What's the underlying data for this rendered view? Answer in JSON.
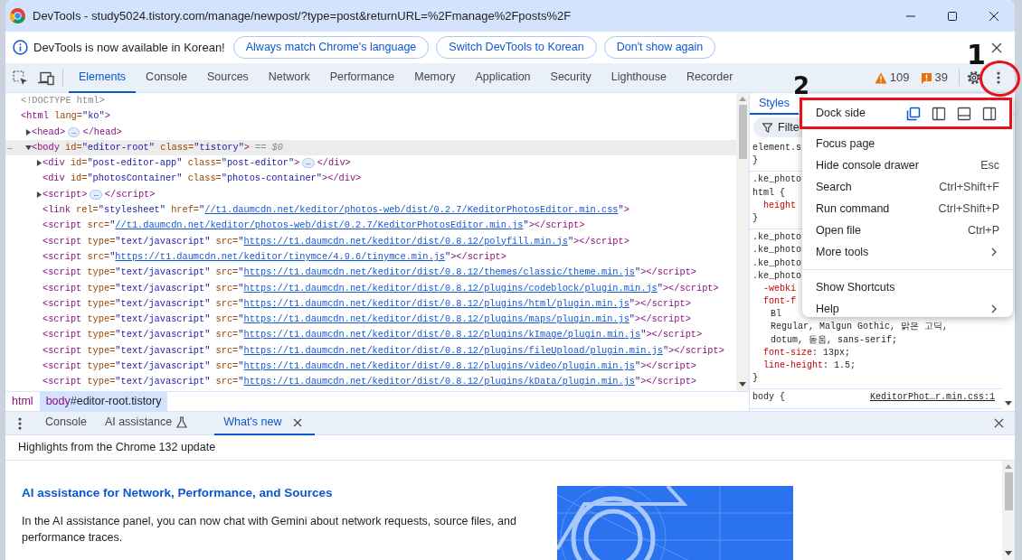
{
  "window": {
    "title": "DevTools - study5024.tistory.com/manage/newpost/?type=post&returnURL=%2Fmanage%2Fposts%2F"
  },
  "infobar": {
    "message": "DevTools is now available in Korean!",
    "buttons": [
      "Always match Chrome's language",
      "Switch DevTools to Korean",
      "Don't show again"
    ]
  },
  "tabs": [
    {
      "label": "Elements",
      "selected": true
    },
    {
      "label": "Console",
      "selected": false
    },
    {
      "label": "Sources",
      "selected": false
    },
    {
      "label": "Network",
      "selected": false
    },
    {
      "label": "Performance",
      "selected": false
    },
    {
      "label": "Memory",
      "selected": false
    },
    {
      "label": "Application",
      "selected": false
    },
    {
      "label": "Security",
      "selected": false
    },
    {
      "label": "Lighthouse",
      "selected": false
    },
    {
      "label": "Recorder",
      "selected": false
    }
  ],
  "counters": [
    {
      "kind": "warning",
      "count": "109"
    },
    {
      "kind": "issue",
      "count": "39"
    }
  ],
  "dom_tree": [
    {
      "tokens": [
        {
          "kind": "comment",
          "text": "<!DOCTYPE html>"
        }
      ],
      "selected": false
    },
    {
      "tokens": [
        {
          "kind": "tag",
          "text": "<html"
        },
        {
          "kind": "attr",
          "text": " lang="
        },
        {
          "kind": "value",
          "text": "\"ko\""
        },
        {
          "kind": "tag",
          "text": ">"
        }
      ],
      "selected": false,
      "children": [
        {
          "tokens": [
            {
              "kind": "tag",
              "text": "<head>"
            },
            {
              "kind": "more",
              "text": "…"
            },
            {
              "kind": "tag",
              "text": "</head>"
            }
          ],
          "expanded": false,
          "selected": false
        },
        {
          "tokens": [
            {
              "kind": "tag",
              "text": "<body"
            },
            {
              "kind": "attr",
              "text": " id="
            },
            {
              "kind": "value",
              "text": "\"editor-root\""
            },
            {
              "kind": "attr",
              "text": " class="
            },
            {
              "kind": "value",
              "text": "\"tistory\""
            },
            {
              "kind": "tag",
              "text": ">"
            },
            {
              "kind": "ref",
              "text": "== $0"
            }
          ],
          "expanded": true,
          "selected": true,
          "gutter": "…",
          "children": [
            {
              "tokens": [
                {
                  "kind": "tag",
                  "text": "<div"
                },
                {
                  "kind": "attr",
                  "text": " id="
                },
                {
                  "kind": "value",
                  "text": "\"post-editor-app\""
                },
                {
                  "kind": "attr",
                  "text": " class="
                },
                {
                  "kind": "value",
                  "text": "\"post-editor\""
                },
                {
                  "kind": "tag",
                  "text": ">"
                },
                {
                  "kind": "more",
                  "text": "…"
                },
                {
                  "kind": "tag",
                  "text": "</div>"
                }
              ],
              "expanded": false,
              "selected": false
            },
            {
              "tokens": [
                {
                  "kind": "tag",
                  "text": "<div"
                },
                {
                  "kind": "attr",
                  "text": " id="
                },
                {
                  "kind": "value",
                  "text": "\"photosContainer\""
                },
                {
                  "kind": "attr",
                  "text": " class="
                },
                {
                  "kind": "value",
                  "text": "\"photos-container\""
                },
                {
                  "kind": "tag",
                  "text": "></div>"
                }
              ],
              "selected": false
            },
            {
              "tokens": [
                {
                  "kind": "tag",
                  "text": "<script>"
                },
                {
                  "kind": "more",
                  "text": "…"
                },
                {
                  "kind": "tag",
                  "text": "</script>"
                }
              ],
              "expanded": false,
              "selected": false
            },
            {
              "tokens": [
                {
                  "kind": "tag",
                  "text": "<link"
                },
                {
                  "kind": "attr",
                  "text": " rel="
                },
                {
                  "kind": "value",
                  "text": "\"stylesheet\""
                },
                {
                  "kind": "attr",
                  "text": " href="
                },
                {
                  "kind": "value",
                  "text": "\""
                },
                {
                  "kind": "link",
                  "text": "//t1.daumcdn.net/keditor/photos-web/dist/0.2.7/KeditorPhotosEditor.min.css"
                },
                {
                  "kind": "value",
                  "text": "\""
                },
                {
                  "kind": "tag",
                  "text": ">"
                }
              ],
              "selected": false
            },
            {
              "tokens": [
                {
                  "kind": "tag",
                  "text": "<script"
                },
                {
                  "kind": "attr",
                  "text": " src="
                },
                {
                  "kind": "value",
                  "text": "\""
                },
                {
                  "kind": "link",
                  "text": "//t1.daumcdn.net/keditor/photos-web/dist/0.2.7/KeditorPhotosEditor.min.js"
                },
                {
                  "kind": "value",
                  "text": "\""
                },
                {
                  "kind": "tag",
                  "text": "></script>"
                }
              ],
              "selected": false
            },
            {
              "tokens": [
                {
                  "kind": "tag",
                  "text": "<script"
                },
                {
                  "kind": "attr",
                  "text": " type="
                },
                {
                  "kind": "value",
                  "text": "\"text/javascript\""
                },
                {
                  "kind": "attr",
                  "text": " src="
                },
                {
                  "kind": "value",
                  "text": "\""
                },
                {
                  "kind": "link",
                  "text": "https://t1.daumcdn.net/keditor/dist/0.8.12/polyfill.min.js"
                },
                {
                  "kind": "value",
                  "text": "\""
                },
                {
                  "kind": "tag",
                  "text": "></script>"
                }
              ],
              "selected": false
            },
            {
              "tokens": [
                {
                  "kind": "tag",
                  "text": "<script"
                },
                {
                  "kind": "attr",
                  "text": " src="
                },
                {
                  "kind": "value",
                  "text": "\""
                },
                {
                  "kind": "link",
                  "text": "https://t1.daumcdn.net/keditor/tinymce/4.9.6/tinymce.min.js"
                },
                {
                  "kind": "value",
                  "text": "\""
                },
                {
                  "kind": "tag",
                  "text": "></script>"
                }
              ],
              "selected": false
            },
            {
              "tokens": [
                {
                  "kind": "tag",
                  "text": "<script"
                },
                {
                  "kind": "attr",
                  "text": " type="
                },
                {
                  "kind": "value",
                  "text": "\"text/javascript\""
                },
                {
                  "kind": "attr",
                  "text": " src="
                },
                {
                  "kind": "value",
                  "text": "\""
                },
                {
                  "kind": "link",
                  "text": "https://t1.daumcdn.net/keditor/dist/0.8.12/themes/classic/theme.min.js"
                },
                {
                  "kind": "value",
                  "text": "\""
                },
                {
                  "kind": "tag",
                  "text": "></script>"
                }
              ],
              "selected": false
            },
            {
              "tokens": [
                {
                  "kind": "tag",
                  "text": "<script"
                },
                {
                  "kind": "attr",
                  "text": " type="
                },
                {
                  "kind": "value",
                  "text": "\"text/javascript\""
                },
                {
                  "kind": "attr",
                  "text": " src="
                },
                {
                  "kind": "value",
                  "text": "\""
                },
                {
                  "kind": "link",
                  "text": "https://t1.daumcdn.net/keditor/dist/0.8.12/plugins/codeblock/plugin.min.js"
                },
                {
                  "kind": "value",
                  "text": "\""
                },
                {
                  "kind": "tag",
                  "text": "></script>"
                }
              ],
              "selected": false
            },
            {
              "tokens": [
                {
                  "kind": "tag",
                  "text": "<script"
                },
                {
                  "kind": "attr",
                  "text": " type="
                },
                {
                  "kind": "value",
                  "text": "\"text/javascript\""
                },
                {
                  "kind": "attr",
                  "text": " src="
                },
                {
                  "kind": "value",
                  "text": "\""
                },
                {
                  "kind": "link",
                  "text": "https://t1.daumcdn.net/keditor/dist/0.8.12/plugins/html/plugin.min.js"
                },
                {
                  "kind": "value",
                  "text": "\""
                },
                {
                  "kind": "tag",
                  "text": "></script>"
                }
              ],
              "selected": false
            },
            {
              "tokens": [
                {
                  "kind": "tag",
                  "text": "<script"
                },
                {
                  "kind": "attr",
                  "text": " type="
                },
                {
                  "kind": "value",
                  "text": "\"text/javascript\""
                },
                {
                  "kind": "attr",
                  "text": " src="
                },
                {
                  "kind": "value",
                  "text": "\""
                },
                {
                  "kind": "link",
                  "text": "https://t1.daumcdn.net/keditor/dist/0.8.12/plugins/maps/plugin.min.js"
                },
                {
                  "kind": "value",
                  "text": "\""
                },
                {
                  "kind": "tag",
                  "text": "></script>"
                }
              ],
              "selected": false
            },
            {
              "tokens": [
                {
                  "kind": "tag",
                  "text": "<script"
                },
                {
                  "kind": "attr",
                  "text": " type="
                },
                {
                  "kind": "value",
                  "text": "\"text/javascript\""
                },
                {
                  "kind": "attr",
                  "text": " src="
                },
                {
                  "kind": "value",
                  "text": "\""
                },
                {
                  "kind": "link",
                  "text": "https://t1.daumcdn.net/keditor/dist/0.8.12/plugins/kImage/plugin.min.js"
                },
                {
                  "kind": "value",
                  "text": "\""
                },
                {
                  "kind": "tag",
                  "text": "></script>"
                }
              ],
              "selected": false
            },
            {
              "tokens": [
                {
                  "kind": "tag",
                  "text": "<script"
                },
                {
                  "kind": "attr",
                  "text": " type="
                },
                {
                  "kind": "value",
                  "text": "\"text/javascript\""
                },
                {
                  "kind": "attr",
                  "text": " src="
                },
                {
                  "kind": "value",
                  "text": "\""
                },
                {
                  "kind": "link",
                  "text": "https://t1.daumcdn.net/keditor/dist/0.8.12/plugins/fileUpload/plugin.min.js"
                },
                {
                  "kind": "value",
                  "text": "\""
                },
                {
                  "kind": "tag",
                  "text": "></script>"
                }
              ],
              "selected": false
            },
            {
              "tokens": [
                {
                  "kind": "tag",
                  "text": "<script"
                },
                {
                  "kind": "attr",
                  "text": " type="
                },
                {
                  "kind": "value",
                  "text": "\"text/javascript\""
                },
                {
                  "kind": "attr",
                  "text": " src="
                },
                {
                  "kind": "value",
                  "text": "\""
                },
                {
                  "kind": "link",
                  "text": "https://t1.daumcdn.net/keditor/dist/0.8.12/plugins/video/plugin.min.js"
                },
                {
                  "kind": "value",
                  "text": "\""
                },
                {
                  "kind": "tag",
                  "text": "></script>"
                }
              ],
              "selected": false
            },
            {
              "tokens": [
                {
                  "kind": "tag",
                  "text": "<script"
                },
                {
                  "kind": "attr",
                  "text": " type="
                },
                {
                  "kind": "value",
                  "text": "\"text/javascript\""
                },
                {
                  "kind": "attr",
                  "text": " src="
                },
                {
                  "kind": "value",
                  "text": "\""
                },
                {
                  "kind": "link",
                  "text": "https://t1.daumcdn.net/keditor/dist/0.8.12/plugins/kData/plugin.min.js"
                },
                {
                  "kind": "value",
                  "text": "\""
                },
                {
                  "kind": "tag",
                  "text": "></script>"
                }
              ],
              "selected": false
            }
          ]
        }
      ]
    }
  ],
  "breadcrumbs": [
    {
      "tag": "html",
      "selected": false
    },
    {
      "tag": "body",
      "rest": "#editor-root.tistory",
      "selected": true
    }
  ],
  "styles": {
    "tab": {
      "label": "Styles",
      "selected": true
    },
    "filter": {
      "placeholder": "Filte"
    },
    "rules": [
      {
        "lines": [
          {
            "kind": "selector",
            "text": "element.s"
          },
          {
            "kind": "brace",
            "text": "}"
          }
        ]
      },
      {
        "lines": [
          {
            "kind": "selector",
            "text": ".ke_photo"
          },
          {
            "kind": "selector",
            "text": "html {"
          },
          {
            "kind": "prop",
            "name": "height"
          },
          {
            "kind": "brace",
            "text": "}"
          }
        ]
      },
      {
        "lines": [
          {
            "kind": "selector",
            "text": ".ke_photo"
          },
          {
            "kind": "selector",
            "text": ".ke_photo"
          },
          {
            "kind": "selector",
            "text": ".ke_photo"
          },
          {
            "kind": "selector",
            "text": ".ke_photo"
          },
          {
            "kind": "prop",
            "name": "-webki"
          },
          {
            "kind": "prop",
            "name": "font-f"
          },
          {
            "kind": "cont",
            "text": "Bl"
          },
          {
            "kind": "cont",
            "text": "Regular, Malgun Gothic, 맑은 고딕,"
          },
          {
            "kind": "cont",
            "text": "dotum, 돋움, sans-serif;"
          },
          {
            "kind": "prop",
            "name": "font-size",
            "value": ": 13px;"
          },
          {
            "kind": "prop",
            "name": "line-height",
            "value": ": 1.5;"
          },
          {
            "kind": "brace",
            "text": "}"
          }
        ]
      },
      {
        "lines": [
          {
            "kind": "selector",
            "text": "body {"
          }
        ],
        "source": "KeditorPhot…r.min.css:1"
      }
    ]
  },
  "menu": {
    "dock": {
      "label": "Dock side",
      "options": [
        {
          "kind": "undock",
          "selected": true
        },
        {
          "kind": "left",
          "selected": false
        },
        {
          "kind": "bottom",
          "selected": false
        },
        {
          "kind": "right",
          "selected": false
        }
      ]
    },
    "sections": [
      [
        {
          "label": "Focus page",
          "submenu": false
        },
        {
          "label": "Hide console drawer",
          "shortcut": "Esc",
          "submenu": false
        },
        {
          "label": "Search",
          "shortcut": "Ctrl+Shift+F",
          "submenu": false
        },
        {
          "label": "Run command",
          "shortcut": "Ctrl+Shift+P",
          "submenu": false
        },
        {
          "label": "Open file",
          "shortcut": "Ctrl+P",
          "submenu": false
        },
        {
          "label": "More tools",
          "submenu": true
        }
      ],
      [
        {
          "label": "Show Shortcuts",
          "submenu": false
        },
        {
          "label": "Help",
          "submenu": true
        }
      ]
    ]
  },
  "drawer": {
    "tabs": [
      {
        "label": "Console",
        "selected": false,
        "experimental": false
      },
      {
        "label": "AI assistance",
        "selected": false,
        "experimental": true
      },
      {
        "label": "What's new",
        "selected": true,
        "experimental": false
      }
    ],
    "header": "Highlights from the Chrome 132 update",
    "article": {
      "heading": "AI assistance for Network, Performance, and Sources",
      "text": "In the AI assistance panel, you can now chat with Gemini about network requests, source files, and performance traces."
    }
  },
  "annotations": [
    {
      "kind": "number",
      "text": "1"
    },
    {
      "kind": "number",
      "text": "2"
    },
    {
      "kind": "ellipse"
    },
    {
      "kind": "rectangle"
    }
  ]
}
